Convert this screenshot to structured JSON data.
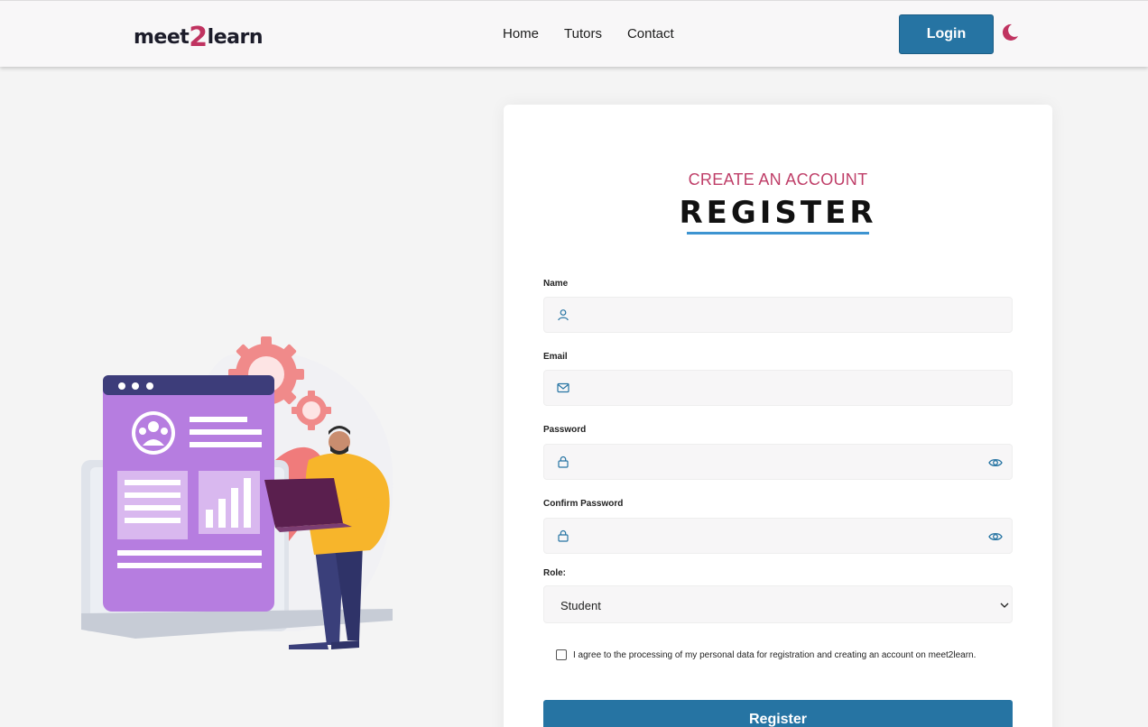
{
  "header": {
    "logo_part1": "meet",
    "logo_two": "2",
    "logo_part2": "learn",
    "nav": [
      "Home",
      "Tutors",
      "Contact"
    ],
    "login_label": "Login",
    "theme_icon": "moon-icon"
  },
  "form": {
    "subtitle": "CREATE AN ACCOUNT",
    "title": "REGISTER",
    "name_label": "Name",
    "name_value": "",
    "email_label": "Email",
    "email_value": "",
    "password_label": "Password",
    "password_value": "",
    "confirm_label": "Confirm Password",
    "confirm_value": "",
    "role_label": "Role:",
    "role_value": "Student",
    "consent_text": "I agree to the processing of my personal data for registration and creating an account on meet2learn.",
    "consent_checked": false,
    "register_label": "Register"
  },
  "colors": {
    "brand": "#2674a3",
    "accent": "#c03360",
    "underline": "#3d94d1"
  }
}
